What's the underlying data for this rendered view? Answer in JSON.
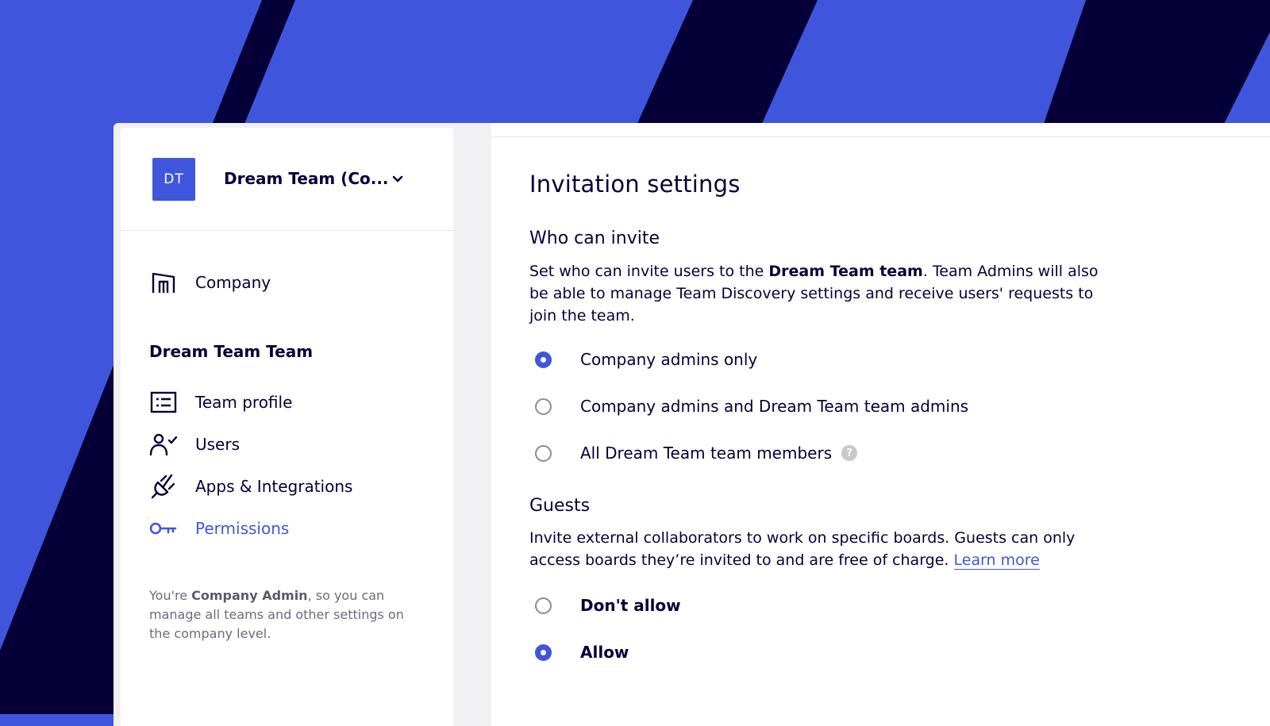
{
  "colors": {
    "brand_blue": "#3f56dc",
    "dark_navy": "#050038",
    "muted_text": "#6b6b7e"
  },
  "sidebar": {
    "avatar_initials": "DT",
    "team_name": "Dream Team (Co...",
    "company_item": {
      "label": "Company",
      "icon": "building-icon"
    },
    "section_title": "Dream Team Team",
    "items": [
      {
        "label": "Team profile",
        "icon": "team-profile-icon",
        "active": false
      },
      {
        "label": "Users",
        "icon": "user-check-icon",
        "active": false
      },
      {
        "label": "Apps & Integrations",
        "icon": "plug-icon",
        "active": false
      },
      {
        "label": "Permissions",
        "icon": "key-icon",
        "active": true
      }
    ],
    "admin_note": {
      "prefix": "You're ",
      "role": "Company Admin",
      "suffix": ", so you can manage all teams and other settings on the company level."
    }
  },
  "main": {
    "title": "Invitation settings",
    "who_can_invite": {
      "heading": "Who can invite",
      "desc_prefix": "Set who can invite users to the ",
      "desc_bold": "Dream Team team",
      "desc_suffix": ". Team Admins will also be able to manage Team Discovery settings and receive users' requests to join the team.",
      "options": [
        {
          "label": "Company admins only",
          "selected": true
        },
        {
          "label": "Company admins and Dream Team team admins",
          "selected": false
        },
        {
          "label": "All Dream Team team members",
          "selected": false,
          "help": "?"
        }
      ]
    },
    "guests": {
      "heading": "Guests",
      "desc": "Invite external collaborators to work on specific boards. Guests can only access boards they’re invited to and are free of charge. ",
      "link": "Learn more",
      "options": [
        {
          "label": "Don't allow",
          "selected": false
        },
        {
          "label": "Allow",
          "selected": true
        }
      ]
    }
  }
}
